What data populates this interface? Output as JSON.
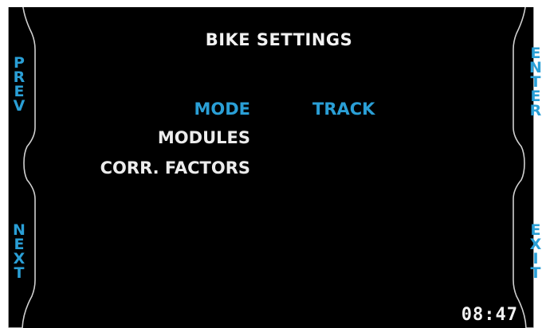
{
  "theme": {
    "accent": "#2a9fd6",
    "text": "#ececec",
    "background": "#000000"
  },
  "header": {
    "title": "BIKE SETTINGS"
  },
  "side_buttons": {
    "prev": "PREV",
    "next": "NEXT",
    "enter": "ENTER",
    "exit": "EXIT"
  },
  "menu": {
    "items": [
      {
        "label": "MODE",
        "value": "TRACK",
        "selected": true
      },
      {
        "label": "MODULES",
        "value": "",
        "selected": false
      },
      {
        "label": "CORR. FACTORS",
        "value": "",
        "selected": false
      }
    ]
  },
  "status": {
    "clock": "08:47"
  }
}
